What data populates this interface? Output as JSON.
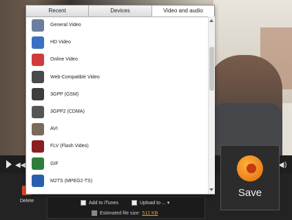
{
  "tabs": [
    {
      "label": "Recent"
    },
    {
      "label": "Devices"
    },
    {
      "label": "Video and audio"
    }
  ],
  "formats": [
    {
      "label": "General Video",
      "icon": "general-video-icon",
      "color": "#6b7fa0"
    },
    {
      "label": "HD Video",
      "icon": "hd-video-icon",
      "color": "#3a6fc4"
    },
    {
      "label": "Online Video",
      "icon": "online-video-icon",
      "color": "#d23b3b"
    },
    {
      "label": "Web-Compatible Video",
      "icon": "html5-video-icon",
      "color": "#4a4a4a"
    },
    {
      "label": "3GPP (GSM)",
      "icon": "3gpp-icon",
      "color": "#3d3d3d"
    },
    {
      "label": "3GPP2 (CDMA)",
      "icon": "3gpp2-icon",
      "color": "#555555"
    },
    {
      "label": "AVI",
      "icon": "avi-icon",
      "color": "#7a6a58"
    },
    {
      "label": "FLV (Flash Video)",
      "icon": "flv-icon",
      "color": "#8a1f1f"
    },
    {
      "label": "GIF",
      "icon": "gif-icon",
      "color": "#2f7d3a"
    },
    {
      "label": "M2TS (MPEG2-TS)",
      "icon": "m2ts-icon",
      "color": "#2a5fb0"
    }
  ],
  "options": {
    "add_to_itunes": "Add to iTunes",
    "upload_to": "Upload to ...",
    "upload_arrow": "▾",
    "estimated_size_label": "Estimated file size:",
    "estimated_size_value": "512 KB"
  },
  "delete_label": "Delete",
  "save_label": "Save",
  "colors": {
    "accent": "#f0a028",
    "delete": "#e34a2b"
  }
}
